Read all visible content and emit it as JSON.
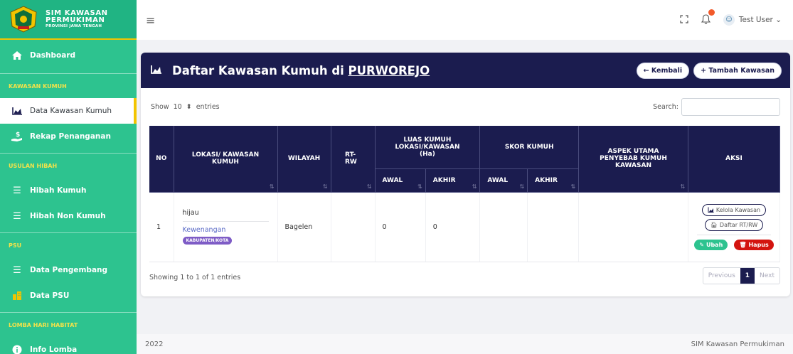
{
  "brand": {
    "line1": "SIM KAWASAN",
    "line2": "PERMUKIMAN",
    "line3": "PROVINSI JAWA TENGAH"
  },
  "sidebar": {
    "dashboard": "Dashboard",
    "sec1": "KAWASAN KUMUH",
    "data_kawasan": "Data Kawasan Kumuh",
    "rekap": "Rekap Penanganan",
    "sec2": "USULAN HIBAH",
    "hibah_kumuh": "Hibah Kumuh",
    "hibah_non": "Hibah Non Kumuh",
    "sec3": "PSU",
    "pengembang": "Data Pengembang",
    "data_psu": "Data PSU",
    "sec4": "LOMBA HARI HABITAT",
    "info_lomba": "Info Lomba"
  },
  "topbar": {
    "user": "Test User ⌄"
  },
  "header": {
    "title_prefix": "Daftar Kawasan Kumuh di ",
    "title_place": "PURWOREJO",
    "back": "← Kembali",
    "add": "+ Tambah Kawasan"
  },
  "controls": {
    "show": "Show",
    "entries_value": "10",
    "entries": "entries",
    "search": "Search:"
  },
  "table": {
    "h_no": "NO",
    "h_lokasi": "LOKASI/ KAWASAN KUMUH",
    "h_wilayah": "WILAYAH",
    "h_rtrw": "RT-RW",
    "h_luas": "LUAS KUMUH LOKASI/KAWASAN (Ha)",
    "h_skor": "SKOR KUMUH",
    "h_aspek": "ASPEK UTAMA PENYEBAB KUMUH KAWASAN",
    "h_aksi": "AKSI",
    "h_awal": "AWAL",
    "h_akhir": "AKHIR",
    "rows": [
      {
        "no": "1",
        "lokasi": "hijau",
        "kewenangan": "Kewenangan",
        "tag": "KABUPATEN/KOTA",
        "wilayah": "Bagelen",
        "rtrw": "",
        "luas_awal": "0",
        "luas_akhir": "0",
        "skor_awal": "",
        "skor_akhir": "",
        "aspek": ""
      }
    ],
    "btn_kelola": "Kelola Kawasan",
    "btn_daftar": "Daftar RT/RW",
    "btn_ubah": "Ubah",
    "btn_hapus": "Hapus"
  },
  "footer": {
    "showing": "Showing 1 to 1 of 1 entries",
    "prev": "Previous",
    "page": "1",
    "next": "Next",
    "year": "2022",
    "app": "SIM Kawasan Permukiman"
  }
}
